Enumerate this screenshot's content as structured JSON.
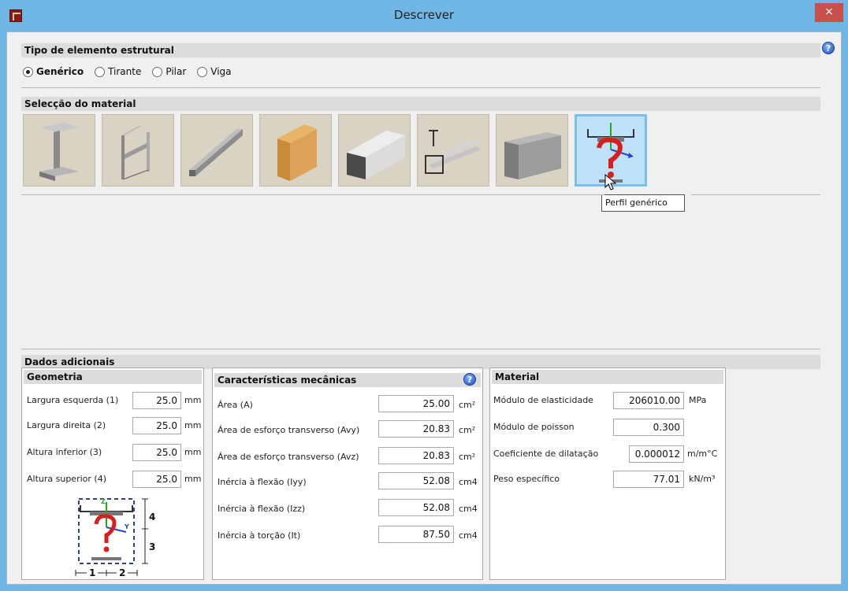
{
  "window": {
    "title": "Descrever",
    "close_glyph": "×"
  },
  "help_glyph": "?",
  "tipo": {
    "header": "Tipo de elemento estrutural",
    "options": [
      {
        "label": "Genérico",
        "selected": true
      },
      {
        "label": "Tirante",
        "selected": false
      },
      {
        "label": "Pilar",
        "selected": false
      },
      {
        "label": "Viga",
        "selected": false
      }
    ]
  },
  "material_selection": {
    "header": "Selecção do material",
    "tiles": [
      "steel-i-beam-icon",
      "steel-h-section-icon",
      "cold-formed-channel-icon",
      "timber-beam-icon",
      "aluminium-box-icon",
      "aluminium-profiles-icon",
      "concrete-block-icon",
      "generic-profile-icon"
    ],
    "selected_index": 7,
    "tooltip": "Perfil genérico"
  },
  "dados": {
    "header": "Dados adicionais",
    "geometria": {
      "title": "Geometria",
      "rows": [
        {
          "label": "Largura esquerda (1)",
          "value": "25.0",
          "unit": "mm"
        },
        {
          "label": "Largura direita (2)",
          "value": "25.0",
          "unit": "mm"
        },
        {
          "label": "Altura inferior (3)",
          "value": "25.0",
          "unit": "mm"
        },
        {
          "label": "Altura superior (4)",
          "value": "25.0",
          "unit": "mm"
        }
      ],
      "diagram_labels": [
        "4",
        "3",
        "1",
        "2",
        "Z",
        "Y"
      ]
    },
    "caracteristicas": {
      "title": "Características mecânicas",
      "rows": [
        {
          "label": "Área (A)",
          "value": "25.00",
          "unit": "cm²"
        },
        {
          "label": "Área de esforço transverso (Avy)",
          "value": "20.83",
          "unit": "cm²"
        },
        {
          "label": "Área de esforço transverso (Avz)",
          "value": "20.83",
          "unit": "cm²"
        },
        {
          "label": "Inércia à flexão (Iyy)",
          "value": "52.08",
          "unit": "cm4"
        },
        {
          "label": "Inércia à flexão (Izz)",
          "value": "52.08",
          "unit": "cm4"
        },
        {
          "label": "Inércia à torção (It)",
          "value": "87.50",
          "unit": "cm4"
        }
      ]
    },
    "material": {
      "title": "Material",
      "rows": [
        {
          "label": "Módulo de elasticidade",
          "value": "206010.00",
          "unit": "MPa"
        },
        {
          "label": "Módulo de poisson",
          "value": "0.300",
          "unit": ""
        },
        {
          "label": "Coeficiente de dilatação",
          "value": "0.000012",
          "unit": "m/m°C"
        },
        {
          "label": "Peso específico",
          "value": "77.01",
          "unit": "kN/m³"
        }
      ]
    }
  }
}
